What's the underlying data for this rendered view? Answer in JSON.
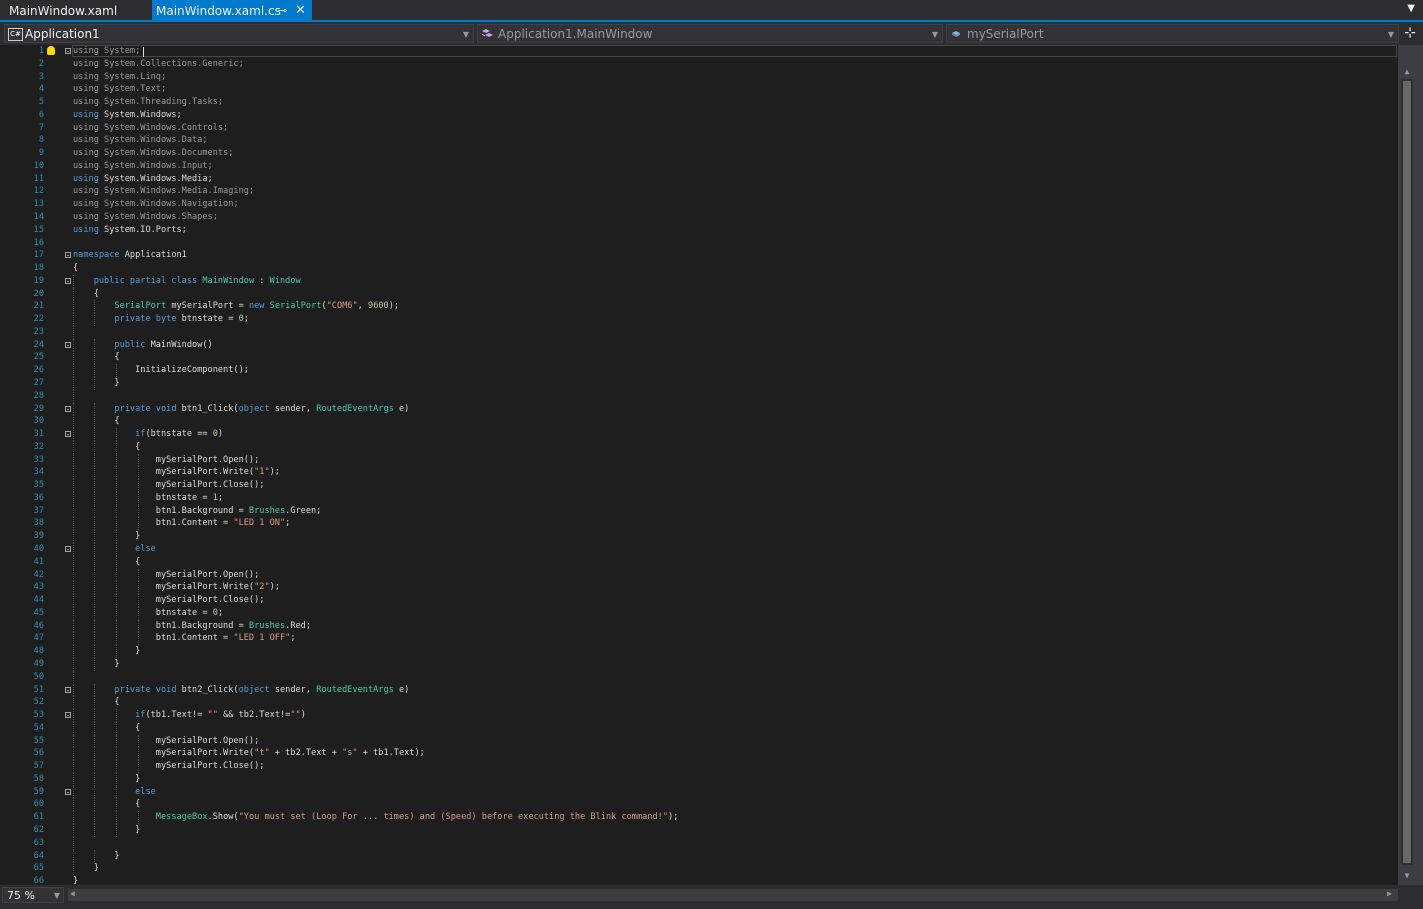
{
  "tabs": [
    {
      "label": "MainWindow.xaml",
      "active": false
    },
    {
      "label": "MainWindow.xaml.cs",
      "active": true
    }
  ],
  "tab_icons": {
    "pin": "⊸",
    "close": "✕",
    "overflow": "▼"
  },
  "navbar": {
    "project_badge": "C#",
    "project": "Application1",
    "class": "Application1.MainWindow",
    "member": "mySerialPort"
  },
  "status": {
    "zoom": "75 %"
  },
  "colors": {
    "background": "#1e1e1e",
    "chrome": "#2d2d30",
    "accent": "#007acc",
    "keyword": "#569cd6",
    "type": "#4ec9b0",
    "string": "#d69d85",
    "number": "#b5cea8",
    "line_number": "#2b91af"
  },
  "code_lines": [
    {
      "n": "1",
      "parts": [
        {
          "t": "using",
          "c": "kw dim"
        },
        {
          "t": " System;",
          "c": "dim"
        }
      ]
    },
    {
      "n": "2",
      "parts": [
        {
          "t": "using",
          "c": "kw dim"
        },
        {
          "t": " System.Collections.Generic;",
          "c": "dim"
        }
      ]
    },
    {
      "n": "3",
      "parts": [
        {
          "t": "using",
          "c": "kw dim"
        },
        {
          "t": " System.Linq;",
          "c": "dim"
        }
      ]
    },
    {
      "n": "4",
      "parts": [
        {
          "t": "using",
          "c": "kw dim"
        },
        {
          "t": " System.Text;",
          "c": "dim"
        }
      ]
    },
    {
      "n": "5",
      "parts": [
        {
          "t": "using",
          "c": "kw dim"
        },
        {
          "t": " System.Threading.Tasks;",
          "c": "dim"
        }
      ]
    },
    {
      "n": "6",
      "parts": [
        {
          "t": "using",
          "c": "kw"
        },
        {
          "t": " System.Windows;",
          "c": ""
        }
      ]
    },
    {
      "n": "7",
      "parts": [
        {
          "t": "using",
          "c": "kw dim"
        },
        {
          "t": " System.Windows.Controls;",
          "c": "dim"
        }
      ]
    },
    {
      "n": "8",
      "parts": [
        {
          "t": "using",
          "c": "kw dim"
        },
        {
          "t": " System.Windows.Data;",
          "c": "dim"
        }
      ]
    },
    {
      "n": "9",
      "parts": [
        {
          "t": "using",
          "c": "kw dim"
        },
        {
          "t": " System.Windows.Documents;",
          "c": "dim"
        }
      ]
    },
    {
      "n": "10",
      "parts": [
        {
          "t": "using",
          "c": "kw dim"
        },
        {
          "t": " System.Windows.Input;",
          "c": "dim"
        }
      ]
    },
    {
      "n": "11",
      "parts": [
        {
          "t": "using",
          "c": "kw"
        },
        {
          "t": " System.Windows.Media;",
          "c": ""
        }
      ]
    },
    {
      "n": "12",
      "parts": [
        {
          "t": "using",
          "c": "kw dim"
        },
        {
          "t": " System.Windows.Media.Imaging;",
          "c": "dim"
        }
      ]
    },
    {
      "n": "13",
      "parts": [
        {
          "t": "using",
          "c": "kw dim"
        },
        {
          "t": " System.Windows.Navigation;",
          "c": "dim"
        }
      ]
    },
    {
      "n": "14",
      "parts": [
        {
          "t": "using",
          "c": "kw dim"
        },
        {
          "t": " System.Windows.Shapes;",
          "c": "dim"
        }
      ]
    },
    {
      "n": "15",
      "parts": [
        {
          "t": "using",
          "c": "kw"
        },
        {
          "t": " System.IO.Ports;",
          "c": ""
        }
      ]
    },
    {
      "n": "16",
      "parts": []
    },
    {
      "n": "17",
      "parts": [
        {
          "t": "namespace",
          "c": "kw"
        },
        {
          "t": " Application1",
          "c": ""
        }
      ]
    },
    {
      "n": "18",
      "parts": [
        {
          "t": "{",
          "c": ""
        }
      ]
    },
    {
      "n": "19",
      "parts": [
        {
          "t": "    ",
          "c": ""
        },
        {
          "t": "public partial class",
          "c": "kw"
        },
        {
          "t": " ",
          "c": ""
        },
        {
          "t": "MainWindow",
          "c": "ty"
        },
        {
          "t": " : ",
          "c": ""
        },
        {
          "t": "Window",
          "c": "ty"
        }
      ]
    },
    {
      "n": "20",
      "parts": [
        {
          "t": "    {",
          "c": ""
        }
      ]
    },
    {
      "n": "21",
      "parts": [
        {
          "t": "        ",
          "c": ""
        },
        {
          "t": "SerialPort",
          "c": "ty"
        },
        {
          "t": " mySerialPort = ",
          "c": ""
        },
        {
          "t": "new",
          "c": "kw"
        },
        {
          "t": " ",
          "c": ""
        },
        {
          "t": "SerialPort",
          "c": "ty"
        },
        {
          "t": "(",
          "c": ""
        },
        {
          "t": "\"COM6\"",
          "c": "st"
        },
        {
          "t": ", ",
          "c": ""
        },
        {
          "t": "9600",
          "c": "nm"
        },
        {
          "t": ");",
          "c": ""
        }
      ]
    },
    {
      "n": "22",
      "parts": [
        {
          "t": "        ",
          "c": ""
        },
        {
          "t": "private byte",
          "c": "kw"
        },
        {
          "t": " btnstate = ",
          "c": ""
        },
        {
          "t": "0",
          "c": "nm"
        },
        {
          "t": ";",
          "c": ""
        }
      ]
    },
    {
      "n": "23",
      "parts": []
    },
    {
      "n": "24",
      "parts": [
        {
          "t": "        ",
          "c": ""
        },
        {
          "t": "public",
          "c": "kw"
        },
        {
          "t": " MainWindow()",
          "c": ""
        }
      ]
    },
    {
      "n": "25",
      "parts": [
        {
          "t": "        {",
          "c": ""
        }
      ]
    },
    {
      "n": "26",
      "parts": [
        {
          "t": "            InitializeComponent();",
          "c": ""
        }
      ]
    },
    {
      "n": "27",
      "parts": [
        {
          "t": "        }",
          "c": ""
        }
      ]
    },
    {
      "n": "28",
      "parts": []
    },
    {
      "n": "29",
      "parts": [
        {
          "t": "        ",
          "c": ""
        },
        {
          "t": "private void",
          "c": "kw"
        },
        {
          "t": " btn1_Click(",
          "c": ""
        },
        {
          "t": "object",
          "c": "kw"
        },
        {
          "t": " sender, ",
          "c": ""
        },
        {
          "t": "RoutedEventArgs",
          "c": "ty"
        },
        {
          "t": " e)",
          "c": ""
        }
      ]
    },
    {
      "n": "30",
      "parts": [
        {
          "t": "        {",
          "c": ""
        }
      ]
    },
    {
      "n": "31",
      "parts": [
        {
          "t": "            ",
          "c": ""
        },
        {
          "t": "if",
          "c": "kw"
        },
        {
          "t": "(btnstate == ",
          "c": ""
        },
        {
          "t": "0",
          "c": "nm"
        },
        {
          "t": ")",
          "c": ""
        }
      ]
    },
    {
      "n": "32",
      "parts": [
        {
          "t": "            {",
          "c": ""
        }
      ]
    },
    {
      "n": "33",
      "parts": [
        {
          "t": "                mySerialPort.Open();",
          "c": ""
        }
      ]
    },
    {
      "n": "34",
      "parts": [
        {
          "t": "                mySerialPort.Write(",
          "c": ""
        },
        {
          "t": "\"1\"",
          "c": "st"
        },
        {
          "t": ");",
          "c": ""
        }
      ]
    },
    {
      "n": "35",
      "parts": [
        {
          "t": "                mySerialPort.Close();",
          "c": ""
        }
      ]
    },
    {
      "n": "36",
      "parts": [
        {
          "t": "                btnstate = ",
          "c": ""
        },
        {
          "t": "1",
          "c": "nm"
        },
        {
          "t": ";",
          "c": ""
        }
      ]
    },
    {
      "n": "37",
      "parts": [
        {
          "t": "                btn1.Background = ",
          "c": ""
        },
        {
          "t": "Brushes",
          "c": "ty"
        },
        {
          "t": ".Green;",
          "c": ""
        }
      ]
    },
    {
      "n": "38",
      "parts": [
        {
          "t": "                btn1.Content = ",
          "c": ""
        },
        {
          "t": "\"LED 1 ON\"",
          "c": "st"
        },
        {
          "t": ";",
          "c": ""
        }
      ]
    },
    {
      "n": "39",
      "parts": [
        {
          "t": "            }",
          "c": ""
        }
      ]
    },
    {
      "n": "40",
      "parts": [
        {
          "t": "            ",
          "c": ""
        },
        {
          "t": "else",
          "c": "kw"
        }
      ]
    },
    {
      "n": "41",
      "parts": [
        {
          "t": "            {",
          "c": ""
        }
      ]
    },
    {
      "n": "42",
      "parts": [
        {
          "t": "                mySerialPort.Open();",
          "c": ""
        }
      ]
    },
    {
      "n": "43",
      "parts": [
        {
          "t": "                mySerialPort.Write(",
          "c": ""
        },
        {
          "t": "\"2\"",
          "c": "st"
        },
        {
          "t": ");",
          "c": ""
        }
      ]
    },
    {
      "n": "44",
      "parts": [
        {
          "t": "                mySerialPort.Close();",
          "c": ""
        }
      ]
    },
    {
      "n": "45",
      "parts": [
        {
          "t": "                btnstate = ",
          "c": ""
        },
        {
          "t": "0",
          "c": "nm"
        },
        {
          "t": ";",
          "c": ""
        }
      ]
    },
    {
      "n": "46",
      "parts": [
        {
          "t": "                btn1.Background = ",
          "c": ""
        },
        {
          "t": "Brushes",
          "c": "ty"
        },
        {
          "t": ".Red;",
          "c": ""
        }
      ]
    },
    {
      "n": "47",
      "parts": [
        {
          "t": "                btn1.Content = ",
          "c": ""
        },
        {
          "t": "\"LED 1 OFF\"",
          "c": "st"
        },
        {
          "t": ";",
          "c": ""
        }
      ]
    },
    {
      "n": "48",
      "parts": [
        {
          "t": "            }",
          "c": ""
        }
      ]
    },
    {
      "n": "49",
      "parts": [
        {
          "t": "        }",
          "c": ""
        }
      ]
    },
    {
      "n": "50",
      "parts": []
    },
    {
      "n": "51",
      "parts": [
        {
          "t": "        ",
          "c": ""
        },
        {
          "t": "private void",
          "c": "kw"
        },
        {
          "t": " btn2_Click(",
          "c": ""
        },
        {
          "t": "object",
          "c": "kw"
        },
        {
          "t": " sender, ",
          "c": ""
        },
        {
          "t": "RoutedEventArgs",
          "c": "ty"
        },
        {
          "t": " e)",
          "c": ""
        }
      ]
    },
    {
      "n": "52",
      "parts": [
        {
          "t": "        {",
          "c": ""
        }
      ]
    },
    {
      "n": "53",
      "parts": [
        {
          "t": "            ",
          "c": ""
        },
        {
          "t": "if",
          "c": "kw"
        },
        {
          "t": "(tb1.Text!= ",
          "c": ""
        },
        {
          "t": "\"\"",
          "c": "st"
        },
        {
          "t": " && tb2.Text!=",
          "c": ""
        },
        {
          "t": "\"\"",
          "c": "st"
        },
        {
          "t": ")",
          "c": ""
        }
      ]
    },
    {
      "n": "54",
      "parts": [
        {
          "t": "            {",
          "c": ""
        }
      ]
    },
    {
      "n": "55",
      "parts": [
        {
          "t": "                mySerialPort.Open();",
          "c": ""
        }
      ]
    },
    {
      "n": "56",
      "parts": [
        {
          "t": "                mySerialPort.Write(",
          "c": ""
        },
        {
          "t": "\"t\"",
          "c": "st"
        },
        {
          "t": " + tb2.Text + ",
          "c": ""
        },
        {
          "t": "\"s\"",
          "c": "st"
        },
        {
          "t": " + tb1.Text);",
          "c": ""
        }
      ]
    },
    {
      "n": "57",
      "parts": [
        {
          "t": "                mySerialPort.Close();",
          "c": ""
        }
      ]
    },
    {
      "n": "58",
      "parts": [
        {
          "t": "            }",
          "c": ""
        }
      ]
    },
    {
      "n": "59",
      "parts": [
        {
          "t": "            ",
          "c": ""
        },
        {
          "t": "else",
          "c": "kw"
        }
      ]
    },
    {
      "n": "60",
      "parts": [
        {
          "t": "            {",
          "c": ""
        }
      ]
    },
    {
      "n": "61",
      "parts": [
        {
          "t": "                ",
          "c": ""
        },
        {
          "t": "MessageBox",
          "c": "ty"
        },
        {
          "t": ".Show(",
          "c": ""
        },
        {
          "t": "\"You must set (Loop For ... times) and (Speed) before executing the Blink command!\"",
          "c": "st"
        },
        {
          "t": ");",
          "c": ""
        }
      ]
    },
    {
      "n": "62",
      "parts": [
        {
          "t": "            }",
          "c": ""
        }
      ]
    },
    {
      "n": "63",
      "parts": []
    },
    {
      "n": "64",
      "parts": [
        {
          "t": "        }",
          "c": ""
        }
      ]
    },
    {
      "n": "65",
      "parts": [
        {
          "t": "    }",
          "c": ""
        }
      ]
    },
    {
      "n": "66",
      "parts": [
        {
          "t": "}",
          "c": ""
        }
      ]
    }
  ]
}
